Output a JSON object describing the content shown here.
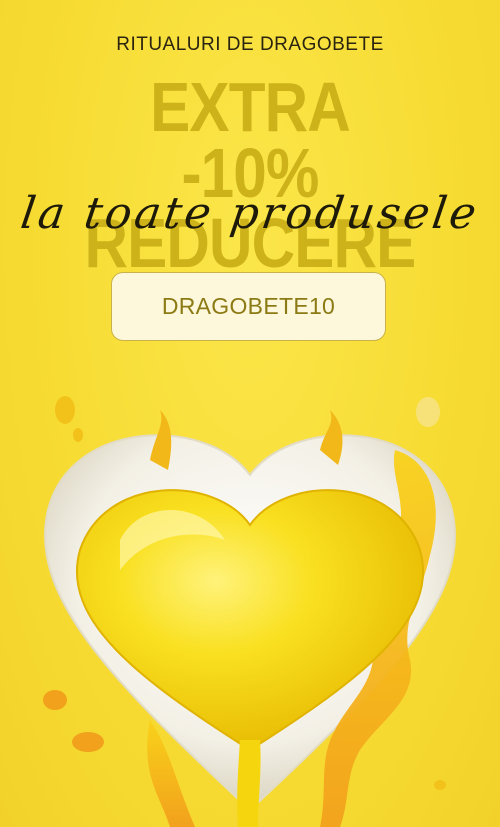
{
  "banner": {
    "kicker": "RITUALURI DE DRAGOBETE",
    "headline_line1": "EXTRA",
    "headline_line2": "-10% REDUCERE",
    "script_line": "la toate produsele",
    "coupon_code": "DRAGOBETE10",
    "illustration_icon": "yellow-liquid-heart-icon"
  },
  "colors": {
    "background": "#f7dc34",
    "headline": "#cdb21a",
    "coupon_bg": "#fdf8dc",
    "coupon_text": "#8c7a14",
    "heart": "#f5d60e",
    "plate": "#f3f0e6",
    "drip_orange": "#f5a623"
  }
}
